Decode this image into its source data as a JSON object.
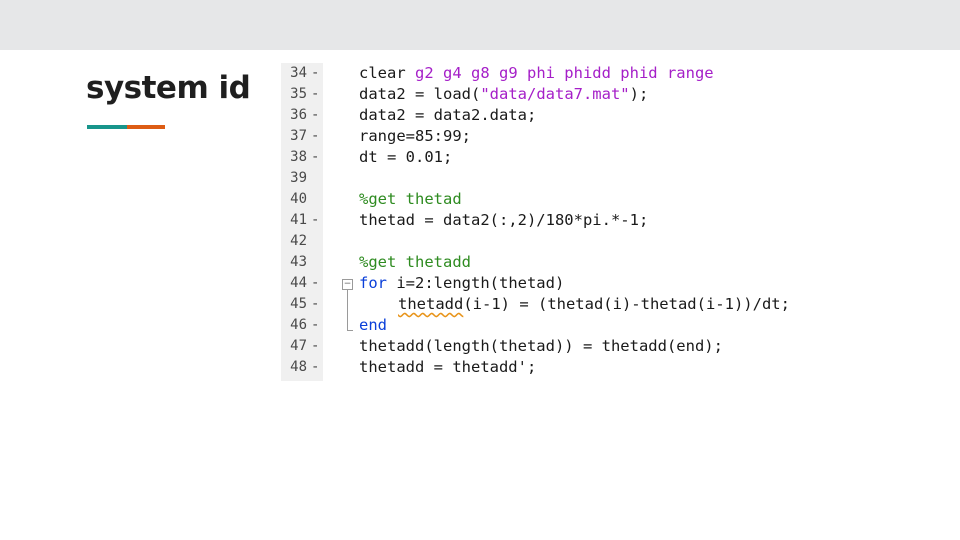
{
  "slide": {
    "title": "system id",
    "accent_colors": [
      "#17958b",
      "#dd5c14"
    ]
  },
  "editor": {
    "colors": {
      "keyword": "#0a3fd9",
      "string": "#a51fc8",
      "comment": "#2e8b20",
      "warning_underline": "#e8941a"
    },
    "lines": [
      {
        "num": "34",
        "marker": "-",
        "indent": 0,
        "tokens": [
          {
            "t": "clear ",
            "c": ""
          },
          {
            "t": "g2 g4 g8 g9 phi phidd phid range",
            "c": "str"
          }
        ]
      },
      {
        "num": "35",
        "marker": "-",
        "indent": 0,
        "tokens": [
          {
            "t": "data2 = load(",
            "c": ""
          },
          {
            "t": "\"data/data7.mat\"",
            "c": "str"
          },
          {
            "t": ");",
            "c": ""
          }
        ]
      },
      {
        "num": "36",
        "marker": "-",
        "indent": 0,
        "tokens": [
          {
            "t": "data2 = data2.data;",
            "c": ""
          }
        ]
      },
      {
        "num": "37",
        "marker": "-",
        "indent": 0,
        "tokens": [
          {
            "t": "range=85:99;",
            "c": ""
          }
        ]
      },
      {
        "num": "38",
        "marker": "-",
        "indent": 0,
        "tokens": [
          {
            "t": "dt = 0.01;",
            "c": ""
          }
        ]
      },
      {
        "num": "39",
        "marker": "",
        "indent": 0,
        "tokens": []
      },
      {
        "num": "40",
        "marker": "",
        "indent": 0,
        "tokens": [
          {
            "t": "%get thetad",
            "c": "cmt"
          }
        ]
      },
      {
        "num": "41",
        "marker": "-",
        "indent": 0,
        "tokens": [
          {
            "t": "thetad = data2(:,2)/180*pi.*-1;",
            "c": ""
          }
        ]
      },
      {
        "num": "42",
        "marker": "",
        "indent": 0,
        "tokens": []
      },
      {
        "num": "43",
        "marker": "",
        "indent": 0,
        "tokens": [
          {
            "t": "%get thetadd",
            "c": "cmt"
          }
        ]
      },
      {
        "num": "44",
        "marker": "-",
        "indent": 0,
        "tokens": [
          {
            "t": "for",
            "c": "kw"
          },
          {
            "t": " i=2:length(thetad)",
            "c": ""
          }
        ]
      },
      {
        "num": "45",
        "marker": "-",
        "indent": 1,
        "tokens": [
          {
            "t": "thetadd",
            "c": "warn"
          },
          {
            "t": "(i-1) = (thetad(i)-thetad(i-1))/dt;",
            "c": ""
          }
        ]
      },
      {
        "num": "46",
        "marker": "-",
        "indent": 0,
        "tokens": [
          {
            "t": "end",
            "c": "kw"
          }
        ]
      },
      {
        "num": "47",
        "marker": "-",
        "indent": 0,
        "tokens": [
          {
            "t": "thetadd(length(thetad)) = thetadd(end);",
            "c": ""
          }
        ]
      },
      {
        "num": "48",
        "marker": "-",
        "indent": 0,
        "tokens": [
          {
            "t": "thetadd = thetadd';",
            "c": ""
          }
        ]
      }
    ]
  }
}
